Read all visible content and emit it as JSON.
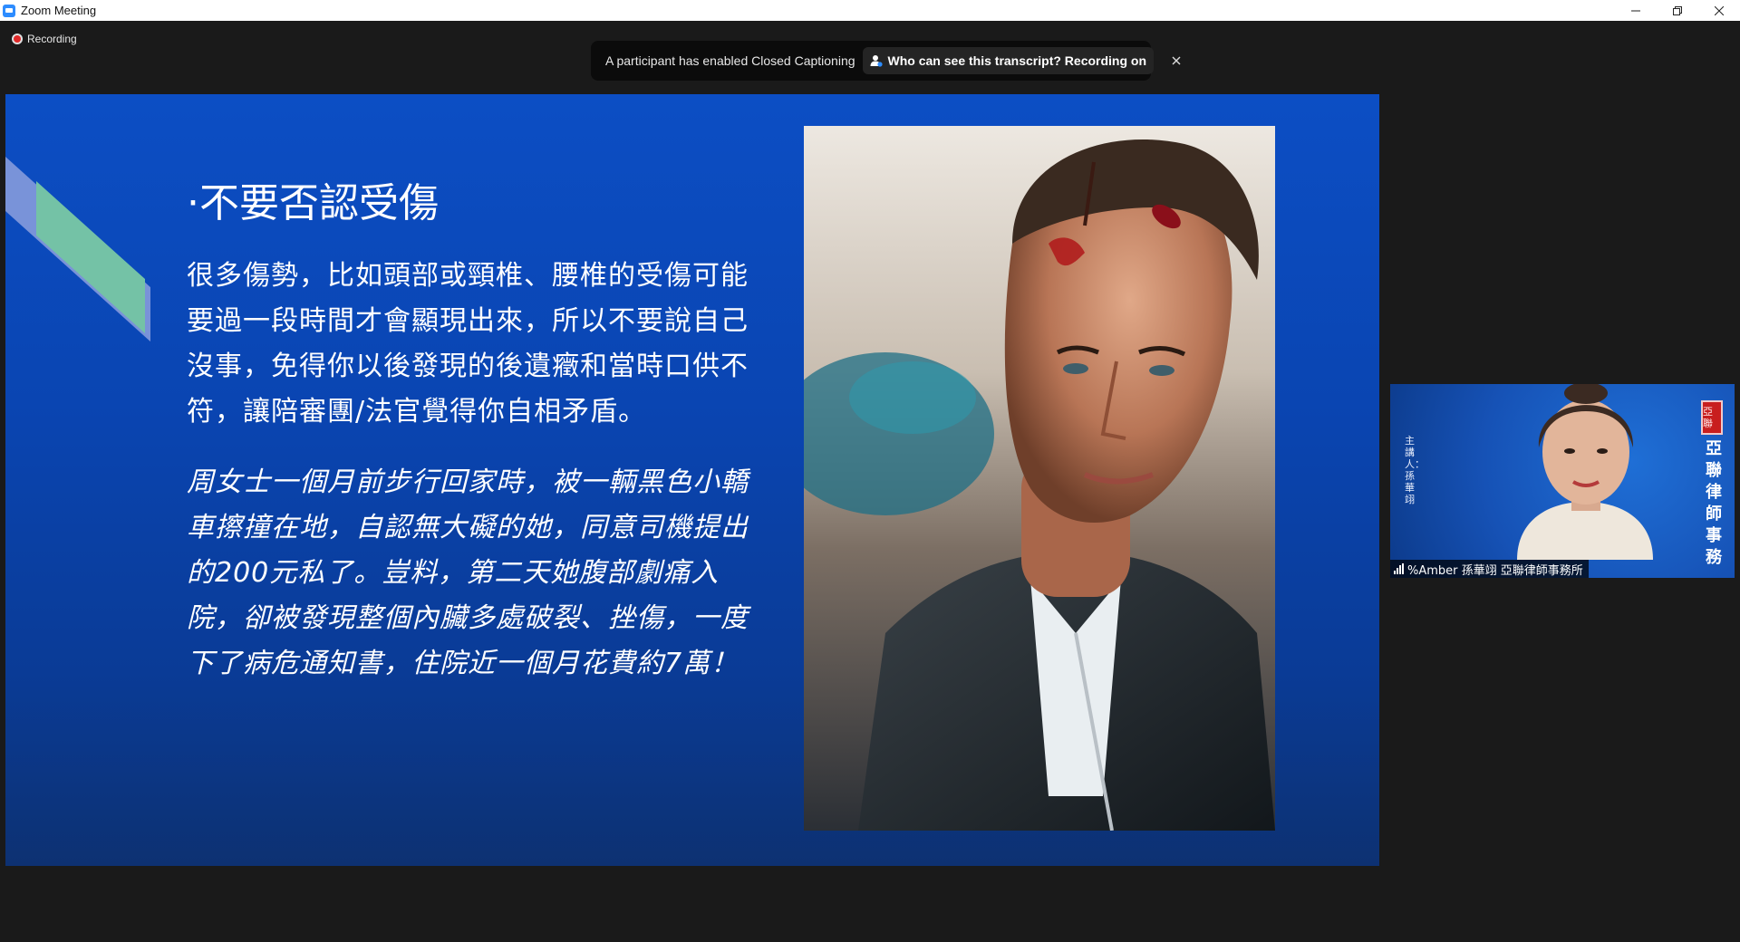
{
  "window": {
    "title": "Zoom Meeting",
    "controls": {
      "minimize": "minimize-icon",
      "restore": "restore-icon",
      "close": "close-icon"
    }
  },
  "recording": {
    "label": "Recording",
    "dot_color": "#e02828"
  },
  "cc_banner": {
    "message": "A participant has enabled Closed Captioning",
    "who_label": "Who can see this transcript? Recording on",
    "close": "close-icon"
  },
  "slide": {
    "title": "·不要否認受傷",
    "paragraph1": "很多傷勢，比如頭部或頸椎、腰椎的受傷可能要過一段時間才會顯現出來，所以不要說自己沒事，免得你以後發現的後遺癥和當時口供不符，讓陪審團/法官覺得你自相矛盾。",
    "paragraph2": "周女士一個月前步行回家時，被一輛黑色小轎車擦撞在地，自認無大礙的她，同意司機提出的200元私了。豈料，第二天她腹部劇痛入院，卻被發現整個內臟多處破裂、挫傷，一度下了病危通知書，住院近一個月花費約7萬！",
    "colors": {
      "background": "#0c4ec4",
      "accent_blue": "#7f97da",
      "accent_green": "#74c2a6"
    }
  },
  "participant": {
    "name": "%Amber 孫華翊 亞聯律師事務所",
    "banner_left": "主講人：孫華翊",
    "banner_right": "亞聯律師事務",
    "seal_text": "亞聯"
  }
}
